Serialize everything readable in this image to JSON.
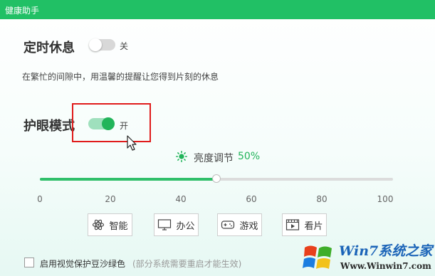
{
  "window": {
    "title": "健康助手"
  },
  "rest": {
    "title": "定时休息",
    "toggle_state": "off",
    "state_label": "关",
    "description": "在繁忙的间隙中，用温馨的提醒让您得到片刻的休息"
  },
  "eye": {
    "title": "护眼模式",
    "toggle_state": "on",
    "state_label": "开"
  },
  "brightness": {
    "label": "亮度调节",
    "value_text": "50%",
    "value": 50,
    "ticks": [
      "0",
      "20",
      "40",
      "60",
      "80",
      "100"
    ]
  },
  "modes": [
    {
      "label": "智能",
      "icon": "atom-icon"
    },
    {
      "label": "办公",
      "icon": "monitor-icon"
    },
    {
      "label": "游戏",
      "icon": "gamepad-icon"
    },
    {
      "label": "看片",
      "icon": "film-icon"
    }
  ],
  "footer": {
    "checkbox_label": "启用视觉保护豆沙绿色",
    "note": "(部分系统需要重启才能生效)"
  },
  "watermark": {
    "brand": "Win7系统之家",
    "url": "Www.Winwin7.com"
  },
  "colors": {
    "accent": "#21c065",
    "highlight": "#e01b1b",
    "link_blue": "#1b64b8"
  }
}
